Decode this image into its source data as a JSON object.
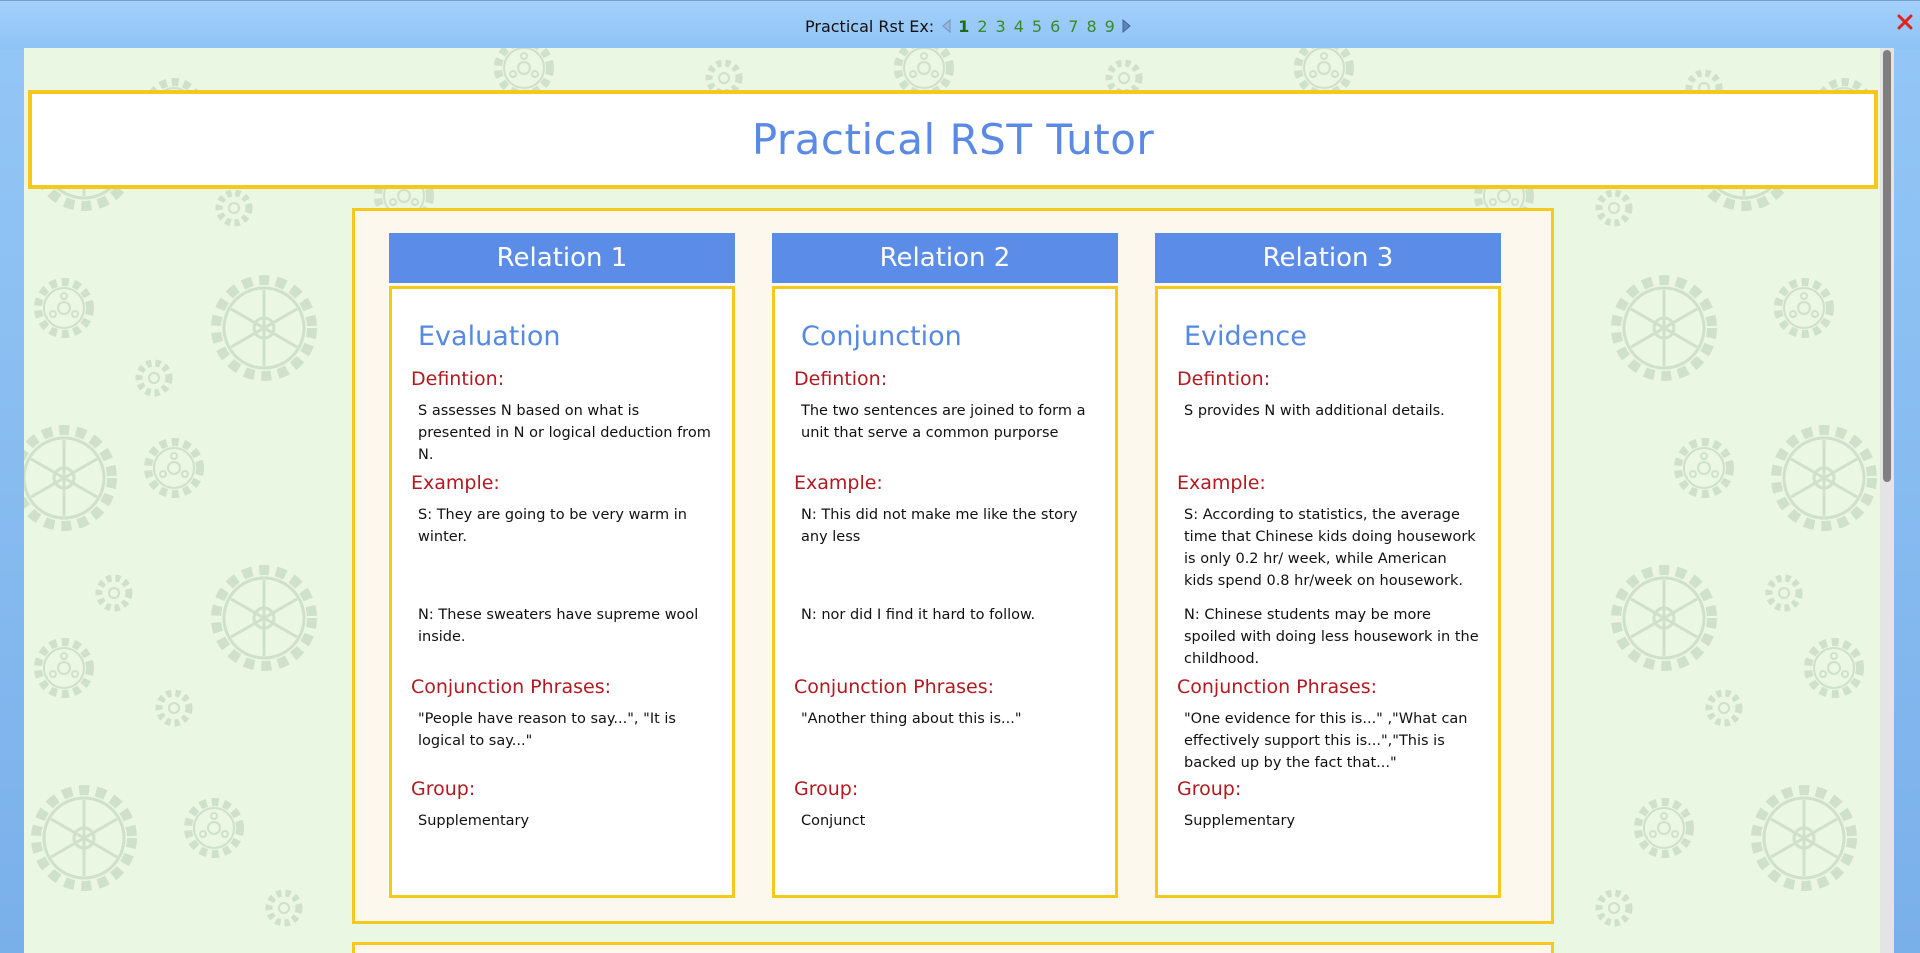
{
  "pager": {
    "label": "Practical Rst Ex:",
    "pages": [
      "1",
      "2",
      "3",
      "4",
      "5",
      "6",
      "7",
      "8",
      "9"
    ],
    "active_page": "1"
  },
  "title": "Practical RST Tutor",
  "section_labels": {
    "definition": "Defintion:",
    "example": "Example:",
    "conjunction": "Conjunction Phrases:",
    "group": "Group:"
  },
  "relations": [
    {
      "header": "Relation 1",
      "name": "Evaluation",
      "definition": "S assesses N based on what is presented in N or logical deduction from N.",
      "example_s": "S: They are going to be very warm in winter.",
      "example_n": "N: These sweaters have supreme wool inside.",
      "conjunction_phrases": "\"People have reason to say...\", \"It is logical to say...\"",
      "group": "Supplementary"
    },
    {
      "header": "Relation 2",
      "name": "Conjunction",
      "definition": "The two sentences are joined to form a unit that serve a common purporse",
      "example_s": "N: This did not make me like the story any less",
      "example_n": "N: nor did I find it hard to follow.",
      "conjunction_phrases": "\"Another thing about this is...\"",
      "group": "Conjunct"
    },
    {
      "header": "Relation 3",
      "name": "Evidence",
      "definition": "S provides N with additional details.",
      "example_s": "S: According to statistics, the average time that Chinese kids doing housework is only 0.2 hr/ week, while American kids spend 0.8 hr/week on housework.",
      "example_n": "N: Chinese students may be more spoiled with doing less housework in the childhood.",
      "conjunction_phrases": "\"One evidence for this is...\" ,\"What can effectively support this is...\",\"This is backed up by the fact that...\"",
      "group": "Supplementary"
    }
  ],
  "colors": {
    "accent_blue": "#5b8de8",
    "title_blue": "#5a8ae6",
    "border_yellow": "#f5c91c",
    "section_red": "#b3191f",
    "pager_green": "#3a8a28",
    "background_green": "#e9f7e3"
  },
  "icons": {
    "prev": "triangle-left-icon",
    "next": "triangle-right-icon",
    "close": "close-x-icon",
    "background": "gear-pattern"
  }
}
